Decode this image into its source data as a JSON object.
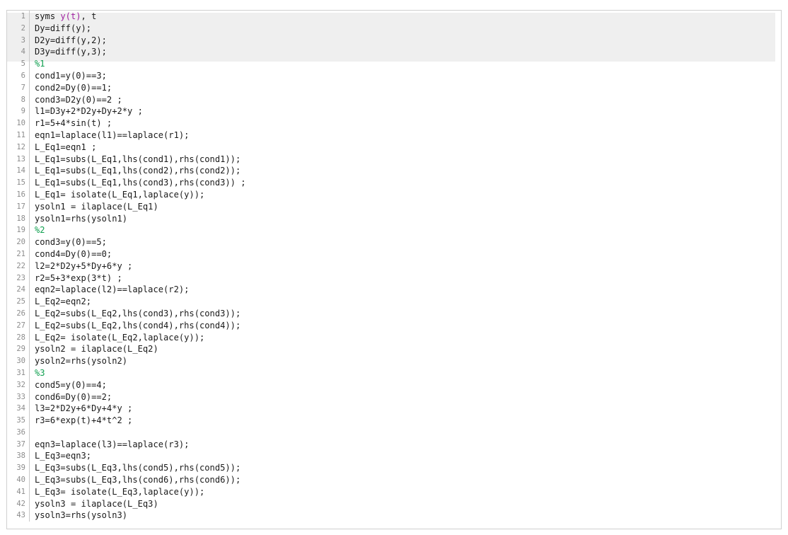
{
  "editor": {
    "language": "matlab",
    "first_line_number": 1,
    "total_lines": 43,
    "highlight": {
      "from_line": 1,
      "to_line": 4,
      "color": "#efefef"
    },
    "colors": {
      "background": "#ffffff",
      "text": "#1a1a1a",
      "line_number": "#8c8c8c",
      "gutter_rule": "#c8c8c8",
      "border": "#cfcfcf",
      "comment": "#10a050",
      "variable": "#a020a0",
      "highlight_band": "#efefef"
    },
    "lines": [
      {
        "number": "1",
        "tokens": [
          {
            "text": "syms ",
            "type": "plain"
          },
          {
            "text": "y(t)",
            "type": "variable"
          },
          {
            "text": ", t",
            "type": "plain"
          }
        ]
      },
      {
        "number": "2",
        "tokens": [
          {
            "text": "Dy=diff(y);",
            "type": "plain"
          }
        ]
      },
      {
        "number": "3",
        "tokens": [
          {
            "text": "D2y=diff(y,2);",
            "type": "plain"
          }
        ]
      },
      {
        "number": "4",
        "tokens": [
          {
            "text": "D3y=diff(y,3);",
            "type": "plain"
          }
        ]
      },
      {
        "number": "5",
        "tokens": [
          {
            "text": "%1",
            "type": "comment"
          }
        ]
      },
      {
        "number": "6",
        "tokens": [
          {
            "text": "cond1=y(0)==3;",
            "type": "plain"
          }
        ]
      },
      {
        "number": "7",
        "tokens": [
          {
            "text": "cond2=Dy(0)==1;",
            "type": "plain"
          }
        ]
      },
      {
        "number": "8",
        "tokens": [
          {
            "text": "cond3=D2y(0)==2 ;",
            "type": "plain"
          }
        ]
      },
      {
        "number": "9",
        "tokens": [
          {
            "text": "l1=D3y+2*D2y+Dy+2*y ;",
            "type": "plain"
          }
        ]
      },
      {
        "number": "10",
        "tokens": [
          {
            "text": "r1=5+4*sin(t) ;",
            "type": "plain"
          }
        ]
      },
      {
        "number": "11",
        "tokens": [
          {
            "text": "eqn1=laplace(l1)==laplace(r1);",
            "type": "plain"
          }
        ]
      },
      {
        "number": "12",
        "tokens": [
          {
            "text": "L_Eq1=eqn1 ;",
            "type": "plain"
          }
        ]
      },
      {
        "number": "13",
        "tokens": [
          {
            "text": "L_Eq1=subs(L_Eq1,lhs(cond1),rhs(cond1));",
            "type": "plain"
          }
        ]
      },
      {
        "number": "14",
        "tokens": [
          {
            "text": "L_Eq1=subs(L_Eq1,lhs(cond2),rhs(cond2));",
            "type": "plain"
          }
        ]
      },
      {
        "number": "15",
        "tokens": [
          {
            "text": "L_Eq1=subs(L_Eq1,lhs(cond3),rhs(cond3)) ;",
            "type": "plain"
          }
        ]
      },
      {
        "number": "16",
        "tokens": [
          {
            "text": "L_Eq1= isolate(L_Eq1,laplace(y));",
            "type": "plain"
          }
        ]
      },
      {
        "number": "17",
        "tokens": [
          {
            "text": "ysoln1 = ilaplace(L_Eq1)",
            "type": "plain"
          }
        ]
      },
      {
        "number": "18",
        "tokens": [
          {
            "text": "ysoln1=rhs(ysoln1)",
            "type": "plain"
          }
        ]
      },
      {
        "number": "19",
        "tokens": [
          {
            "text": "%2",
            "type": "comment"
          }
        ]
      },
      {
        "number": "20",
        "tokens": [
          {
            "text": "cond3=y(0)==5;",
            "type": "plain"
          }
        ]
      },
      {
        "number": "21",
        "tokens": [
          {
            "text": "cond4=Dy(0)==0;",
            "type": "plain"
          }
        ]
      },
      {
        "number": "22",
        "tokens": [
          {
            "text": "l2=2*D2y+5*Dy+6*y ;",
            "type": "plain"
          }
        ]
      },
      {
        "number": "23",
        "tokens": [
          {
            "text": "r2=5+3*exp(3*t) ;",
            "type": "plain"
          }
        ]
      },
      {
        "number": "24",
        "tokens": [
          {
            "text": "eqn2=laplace(l2)==laplace(r2);",
            "type": "plain"
          }
        ]
      },
      {
        "number": "25",
        "tokens": [
          {
            "text": "L_Eq2=eqn2;",
            "type": "plain"
          }
        ]
      },
      {
        "number": "26",
        "tokens": [
          {
            "text": "L_Eq2=subs(L_Eq2,lhs(cond3),rhs(cond3));",
            "type": "plain"
          }
        ]
      },
      {
        "number": "27",
        "tokens": [
          {
            "text": "L_Eq2=subs(L_Eq2,lhs(cond4),rhs(cond4));",
            "type": "plain"
          }
        ]
      },
      {
        "number": "28",
        "tokens": [
          {
            "text": "L_Eq2= isolate(L_Eq2,laplace(y));",
            "type": "plain"
          }
        ]
      },
      {
        "number": "29",
        "tokens": [
          {
            "text": "ysoln2 = ilaplace(L_Eq2)",
            "type": "plain"
          }
        ]
      },
      {
        "number": "30",
        "tokens": [
          {
            "text": "ysoln2=rhs(ysoln2)",
            "type": "plain"
          }
        ]
      },
      {
        "number": "31",
        "tokens": [
          {
            "text": "%3",
            "type": "comment"
          }
        ]
      },
      {
        "number": "32",
        "tokens": [
          {
            "text": "cond5=y(0)==4;",
            "type": "plain"
          }
        ]
      },
      {
        "number": "33",
        "tokens": [
          {
            "text": "cond6=Dy(0)==2;",
            "type": "plain"
          }
        ]
      },
      {
        "number": "34",
        "tokens": [
          {
            "text": "l3=2*D2y+6*Dy+4*y ;",
            "type": "plain"
          }
        ]
      },
      {
        "number": "35",
        "tokens": [
          {
            "text": "r3=6*exp(t)+4*t^2 ;",
            "type": "plain"
          }
        ]
      },
      {
        "number": "36",
        "tokens": [
          {
            "text": "",
            "type": "plain"
          }
        ]
      },
      {
        "number": "37",
        "tokens": [
          {
            "text": "eqn3=laplace(l3)==laplace(r3);",
            "type": "plain"
          }
        ]
      },
      {
        "number": "38",
        "tokens": [
          {
            "text": "L_Eq3=eqn3;",
            "type": "plain"
          }
        ]
      },
      {
        "number": "39",
        "tokens": [
          {
            "text": "L_Eq3=subs(L_Eq3,lhs(cond5),rhs(cond5));",
            "type": "plain"
          }
        ]
      },
      {
        "number": "40",
        "tokens": [
          {
            "text": "L_Eq3=subs(L_Eq3,lhs(cond6),rhs(cond6));",
            "type": "plain"
          }
        ]
      },
      {
        "number": "41",
        "tokens": [
          {
            "text": "L_Eq3= isolate(L_Eq3,laplace(y));",
            "type": "plain"
          }
        ]
      },
      {
        "number": "42",
        "tokens": [
          {
            "text": "ysoln3 = ilaplace(L_Eq3)",
            "type": "plain"
          }
        ]
      },
      {
        "number": "43",
        "tokens": [
          {
            "text": "ysoln3=rhs(ysoln3)",
            "type": "plain"
          }
        ]
      }
    ]
  }
}
